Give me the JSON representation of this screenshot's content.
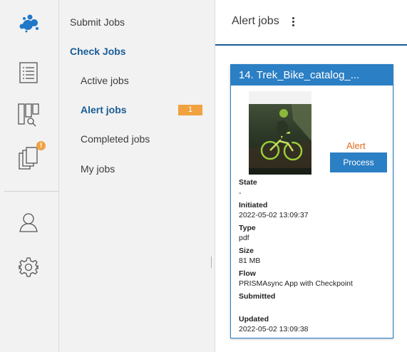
{
  "rail": {
    "icons": [
      "logo-dots-icon",
      "list-icon",
      "board-search-icon",
      "documents-icon",
      "user-icon",
      "gear-icon"
    ],
    "alert_dot_color": "#f0a240"
  },
  "nav": {
    "submit_jobs": "Submit Jobs",
    "check_jobs": "Check Jobs",
    "active_jobs": "Active jobs",
    "alert_jobs": "Alert jobs",
    "alert_count": "1",
    "completed_jobs": "Completed jobs",
    "my_jobs": "My jobs"
  },
  "main": {
    "title": "Alert jobs"
  },
  "job_card": {
    "title": "14. Trek_Bike_catalog_...",
    "status": "Alert",
    "action_label": "Process",
    "fields": {
      "state_label": "State",
      "state_value": "-",
      "initiated_label": "Initiated",
      "initiated_value": "2022-05-02 13:09:37",
      "type_label": "Type",
      "type_value": "pdf",
      "size_label": "Size",
      "size_value": "81 MB",
      "flow_label": "Flow",
      "flow_value": "PRISMAsync App with Checkpoint",
      "submitted_label": "Submitted",
      "updated_label": "Updated",
      "updated_value": "2022-05-02 13:09:38"
    }
  },
  "colors": {
    "accent": "#2b7fc4",
    "nav_active": "#1a5c96",
    "badge": "#f0a240",
    "alert": "#e06b1e",
    "rail_bg": "#f2f2f2"
  }
}
